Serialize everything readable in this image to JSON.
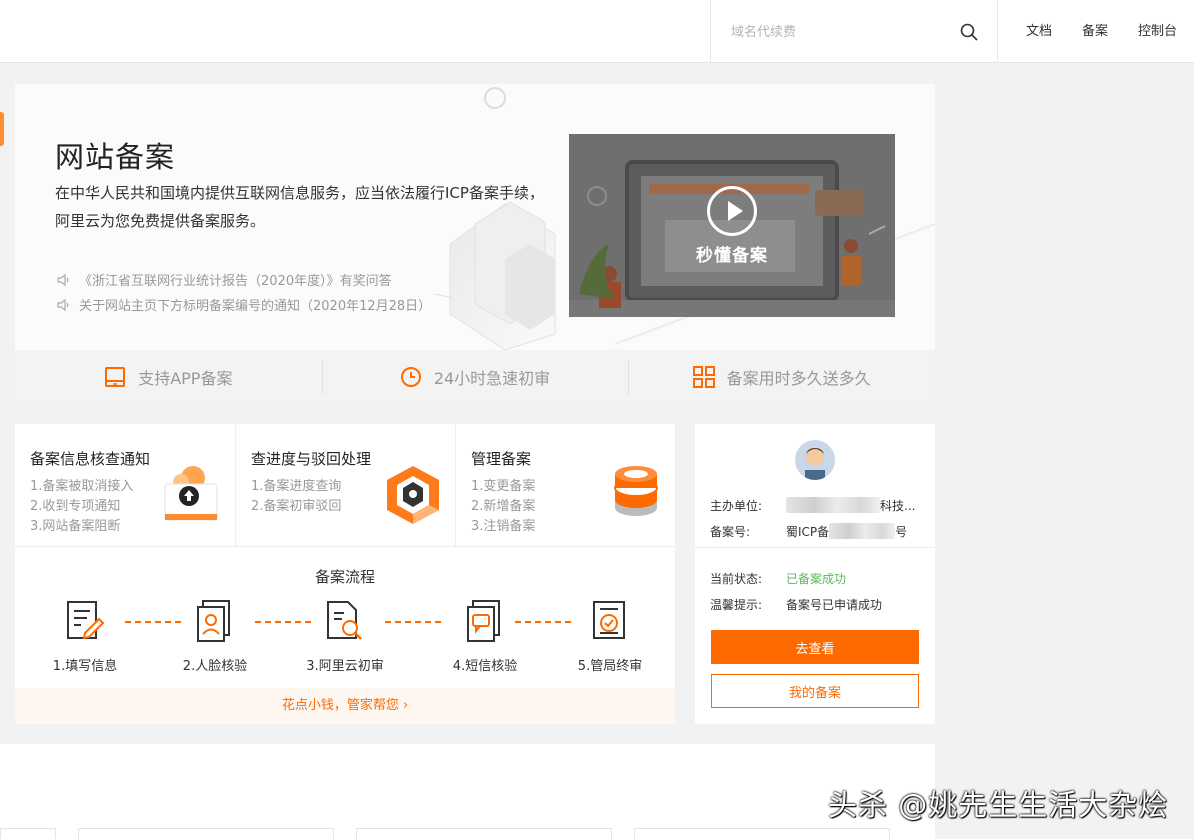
{
  "topbar": {
    "search_placeholder": "域名代续费",
    "nav": [
      "文档",
      "备案",
      "控制台"
    ]
  },
  "hero": {
    "title": "网站备案",
    "description": "在中华人民共和国境内提供互联网信息服务，应当依法履行ICP备案手续，阿里云为您免费提供备案服务。",
    "notices": [
      "《浙江省互联网行业统计报告（2020年度）》有奖问答",
      "关于网站主页下方标明备案编号的通知（2020年12月28日）"
    ],
    "video_label": "秒懂备案",
    "features": [
      "支持APP备案",
      "24小时急速初审",
      "备案用时多久送多久"
    ]
  },
  "services": [
    {
      "title": "备案信息核查通知",
      "items": [
        "1.备案被取消接入",
        "2.收到专项通知",
        "3.网站备案阻断"
      ]
    },
    {
      "title": "查进度与驳回处理",
      "items": [
        "1.备案进度查询",
        "2.备案初审驳回"
      ]
    },
    {
      "title": "管理备案",
      "items": [
        "1.变更备案",
        "2.新增备案",
        "3.注销备案"
      ]
    }
  ],
  "flow": {
    "title": "备案流程",
    "steps": [
      "1.填写信息",
      "2.人脸核验",
      "3.阿里云初审",
      "4.短信核验",
      "5.管局终审"
    ],
    "help_link": "花点小钱，管家帮您 ›"
  },
  "record": {
    "sponsor_label": "主办单位:",
    "sponsor_value_suffix": "科技...",
    "number_label": "备案号:",
    "number_prefix": "蜀ICP备",
    "number_suffix": "号",
    "status_label": "当前状态:",
    "status_value": "已备案成功",
    "tip_label": "温馨提示:",
    "tip_value": "备案号已申请成功",
    "view_button": "去查看",
    "my_record_button": "我的备案"
  },
  "watermark": "头杀 @姚先生生活大杂烩",
  "colors": {
    "accent": "#ff6a00",
    "success": "#5cb85c",
    "page_bg": "#f2f2f2"
  }
}
